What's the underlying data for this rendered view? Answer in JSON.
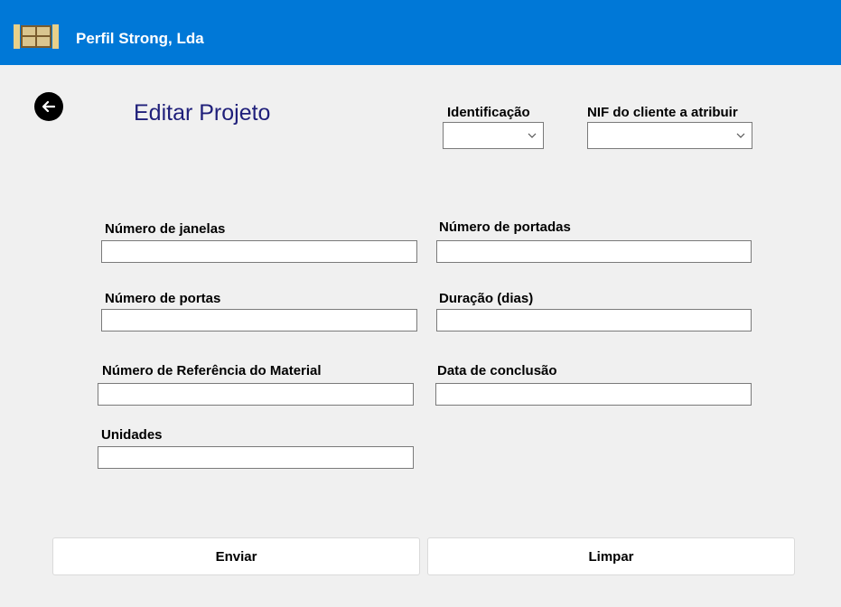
{
  "app": {
    "title": "Perfil Strong, Lda"
  },
  "page": {
    "title": "Editar Projeto"
  },
  "colors": {
    "titlebar": "#0078d7",
    "page_title": "#1f1f7a"
  },
  "icons": {
    "logo": "window-frame-icon",
    "back": "arrow-left-icon",
    "dropdown": "chevron-down-icon"
  },
  "selectors": {
    "identificacao": {
      "label": "Identificação",
      "value": ""
    },
    "nif_cliente": {
      "label": "NIF do cliente a atribuir",
      "value": ""
    }
  },
  "fields": {
    "numero_janelas": {
      "label": "Número de janelas",
      "value": ""
    },
    "numero_portadas": {
      "label": "Número de portadas",
      "value": ""
    },
    "numero_portas": {
      "label": "Número de portas",
      "value": ""
    },
    "duracao_dias": {
      "label": "Duração (dias)",
      "value": ""
    },
    "ref_material": {
      "label": "Número de Referência do Material",
      "value": ""
    },
    "data_conclusao": {
      "label": "Data de conclusão",
      "value": ""
    },
    "unidades": {
      "label": "Unidades",
      "value": ""
    }
  },
  "buttons": {
    "enviar": "Enviar",
    "limpar": "Limpar"
  }
}
